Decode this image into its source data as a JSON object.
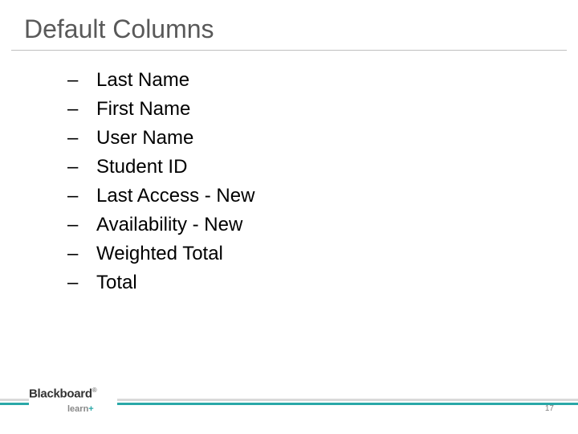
{
  "title": "Default Columns",
  "list": {
    "items": [
      {
        "label": "Last Name"
      },
      {
        "label": "First Name"
      },
      {
        "label": "User Name"
      },
      {
        "label": "Student ID"
      },
      {
        "label": "Last Access - New"
      },
      {
        "label": "Availability - New"
      },
      {
        "label": "Weighted Total"
      },
      {
        "label": "Total"
      }
    ],
    "bullet": "–"
  },
  "logo": {
    "main": "Blackboard",
    "sub": "learn",
    "plus": "+",
    "reg": "®"
  },
  "page_number": "17"
}
